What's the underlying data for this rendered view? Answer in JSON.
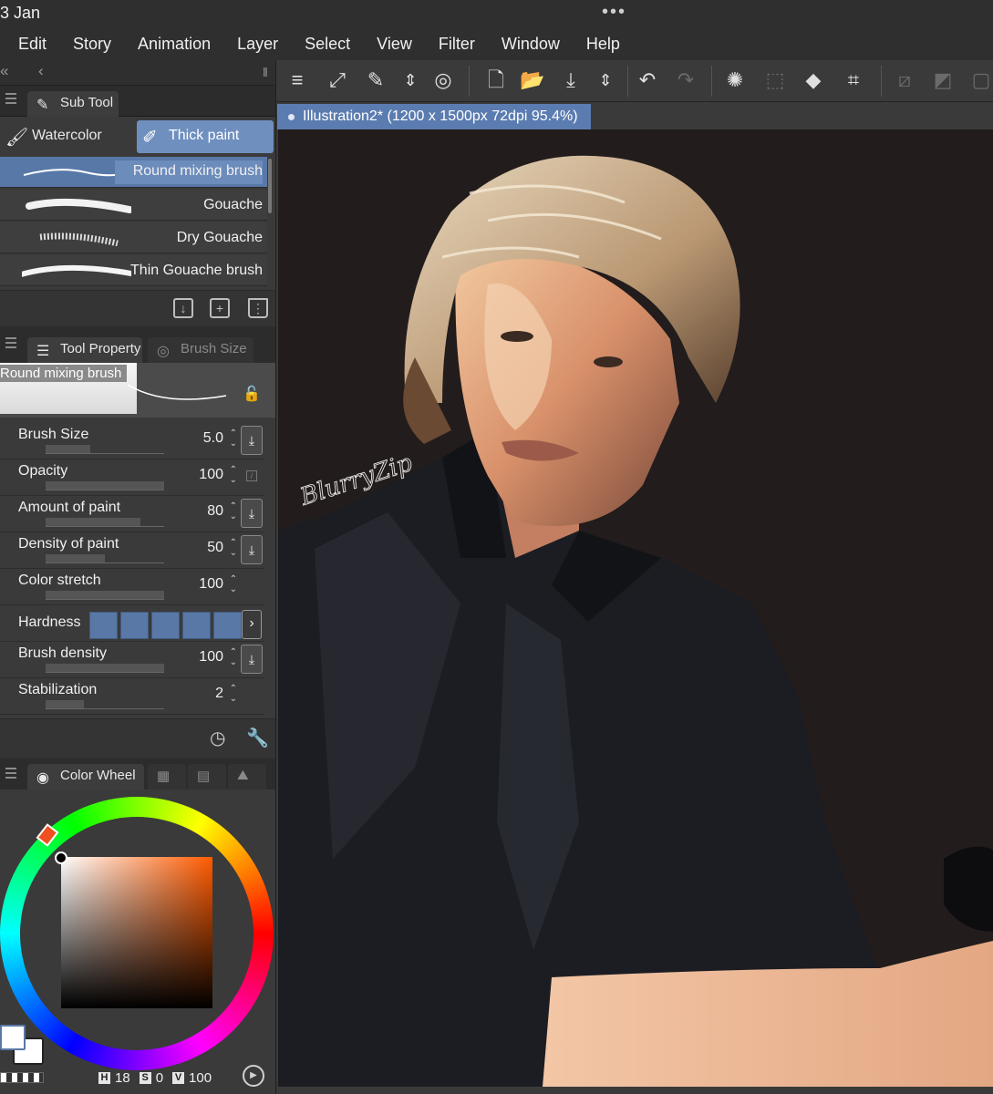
{
  "status": {
    "date": "3 Jan",
    "dots": "•••"
  },
  "menu": [
    "Edit",
    "Story",
    "Animation",
    "Layer",
    "Select",
    "View",
    "Filter",
    "Window",
    "Help"
  ],
  "panel_top": {
    "collapse": "«",
    "back": "‹",
    "grip": "‖"
  },
  "subtool": {
    "tab_label": "Sub Tool",
    "groups": [
      {
        "label": "Watercolor",
        "icon": "brush-icon",
        "active": false
      },
      {
        "label": "Thick paint",
        "icon": "paint-tube-icon",
        "active": true
      }
    ],
    "brushes": [
      {
        "label": "Round mixing brush",
        "selected": true
      },
      {
        "label": "Gouache",
        "selected": false
      },
      {
        "label": "Dry Gouache",
        "selected": false
      },
      {
        "label": "Thin Gouache brush",
        "selected": false
      }
    ]
  },
  "tool_property": {
    "tab_label": "Tool Property",
    "tab2_label": "Brush Size",
    "brush_name": "Round mixing brush",
    "rows": [
      {
        "label": "Brush Size",
        "value": "5.0",
        "fill": 0.38,
        "download": true
      },
      {
        "label": "Opacity",
        "value": "100",
        "fill": 1.0,
        "download": false
      },
      {
        "label": "Amount of paint",
        "value": "80",
        "fill": 0.8,
        "download": true
      },
      {
        "label": "Density of paint",
        "value": "50",
        "fill": 0.5,
        "download": true
      },
      {
        "label": "Color stretch",
        "value": "100",
        "fill": 1.0,
        "download": false
      },
      {
        "label": "Hardness",
        "value": "",
        "fill": 1.0,
        "download": false
      },
      {
        "label": "Brush density",
        "value": "100",
        "fill": 1.0,
        "download": true
      },
      {
        "label": "Stabilization",
        "value": "2",
        "fill": 0.32,
        "download": false
      }
    ]
  },
  "color": {
    "tab_label": "Color Wheel",
    "h": "18",
    "s": "0",
    "v": "100",
    "main_color": "#ffffff",
    "accent": "#5b7cb0"
  },
  "document": {
    "tab_label": "Illustration2* (1200 x 1500px 72dpi 95.4%)"
  },
  "canvas": {
    "signature": "BlurryZip",
    "background": "#221c1c"
  }
}
